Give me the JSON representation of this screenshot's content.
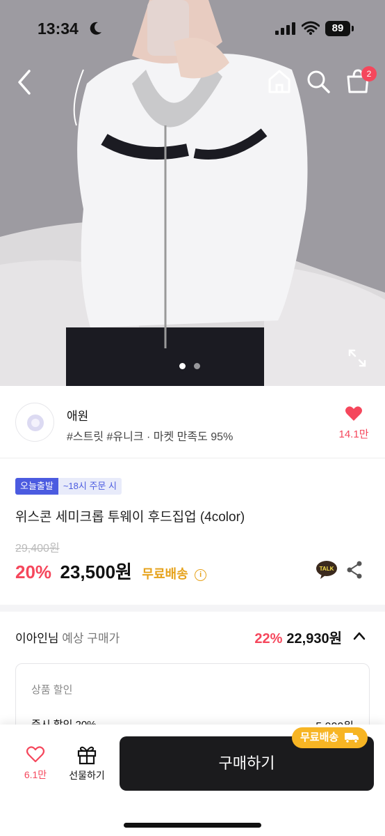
{
  "status_bar": {
    "time": "13:34",
    "battery": "89"
  },
  "header": {
    "cart_count": "2"
  },
  "gallery": {
    "pages": 2,
    "active_page": 1
  },
  "store": {
    "name": "애원",
    "tags": "#스트릿 #유니크 · 마켓 만족도 95%",
    "likes": "14.1만"
  },
  "product": {
    "badge_today": "오늘출발",
    "badge_cutoff": "~18시 주문 시",
    "title": "위스콘 세미크롭 투웨이 후드집업 (4color)",
    "original_price": "29,400원",
    "discount": "20%",
    "price": "23,500원",
    "free_shipping": "무료배송",
    "info_icon": "i",
    "talk_icon": "TALK"
  },
  "expected": {
    "name": "이아인님",
    "label": "예상 구매가",
    "discount": "22%",
    "price": "22,930원"
  },
  "discount_box": {
    "header": "상품 할인",
    "item": "즉시 할인 20%",
    "amount": "5,900원"
  },
  "bottom_bar": {
    "likes": "6.1만",
    "gift_label": "선물하기",
    "buy_label": "구매하기",
    "shipping_badge": "무료배송"
  },
  "colors": {
    "accent": "#f5475c",
    "shipping": "#f7b524",
    "today_badge": "#4b5be0",
    "buy_button": "#1b1b1d"
  }
}
